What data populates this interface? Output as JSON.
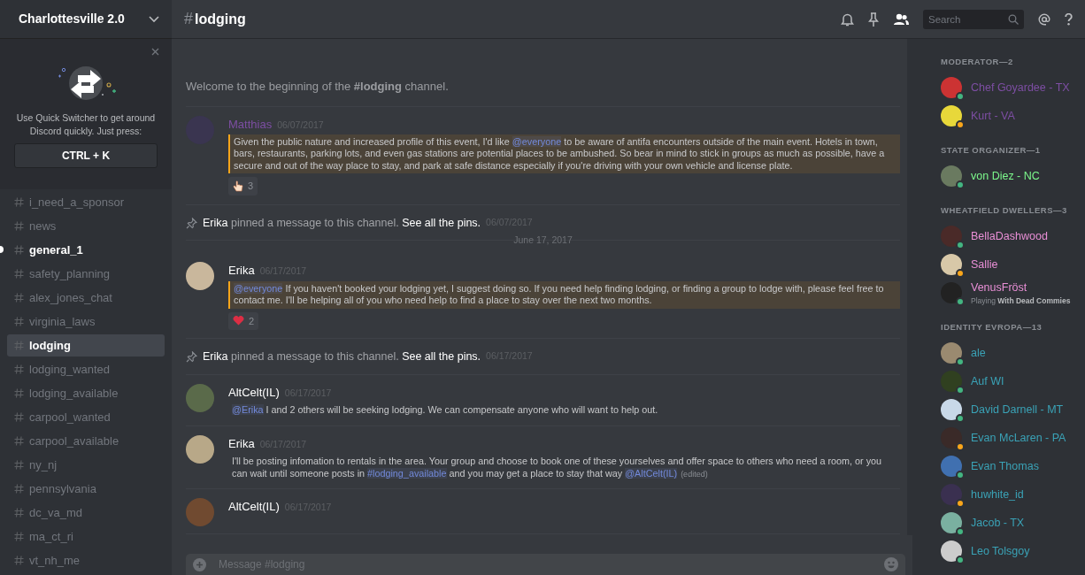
{
  "server": {
    "name": "Charlottesville 2.0"
  },
  "quick_switcher": {
    "text": "Use Quick Switcher to get around Discord quickly. Just press:",
    "shortcut": "CTRL + K"
  },
  "channels": [
    {
      "name": "i_need_a_sponsor",
      "selected": false,
      "unread": false
    },
    {
      "name": "news",
      "selected": false,
      "unread": false
    },
    {
      "name": "general_1",
      "selected": false,
      "unread": true
    },
    {
      "name": "safety_planning",
      "selected": false,
      "unread": false
    },
    {
      "name": "alex_jones_chat",
      "selected": false,
      "unread": false
    },
    {
      "name": "virginia_laws",
      "selected": false,
      "unread": false
    },
    {
      "name": "lodging",
      "selected": true,
      "unread": false
    },
    {
      "name": "lodging_wanted",
      "selected": false,
      "unread": false
    },
    {
      "name": "lodging_available",
      "selected": false,
      "unread": false
    },
    {
      "name": "carpool_wanted",
      "selected": false,
      "unread": false
    },
    {
      "name": "carpool_available",
      "selected": false,
      "unread": false
    },
    {
      "name": "ny_nj",
      "selected": false,
      "unread": false
    },
    {
      "name": "pennsylvania",
      "selected": false,
      "unread": false
    },
    {
      "name": "dc_va_md",
      "selected": false,
      "unread": false
    },
    {
      "name": "ma_ct_ri",
      "selected": false,
      "unread": false
    },
    {
      "name": "vt_nh_me",
      "selected": false,
      "unread": false
    }
  ],
  "header": {
    "hash": "#",
    "channel": "lodging",
    "search_placeholder": "Search"
  },
  "feed": [
    {
      "kind": "welcome",
      "text": "Welcome to the beginning of the **#lodging** channel."
    },
    {
      "kind": "message",
      "author": "Matthias",
      "color": "#7d4ea3",
      "time": "06/07/2017",
      "highlighted": true,
      "parts": [
        {
          "kind": "text",
          "text": "Given the public nature and increased profile of this event, I'd like "
        },
        {
          "kind": "mention",
          "text": "@everyone"
        },
        {
          "kind": "text",
          "text": " to be aware of antifa encounters outside of the main event. Hotels in town, bars, restaurants, parking lots, and even gas stations are potential places to be ambushed. So bear in mind to stick in groups as much as possible, have a secure and out of the way place to stay, and park at safe distance especially if you're driving with your own vehicle and license plate."
        }
      ],
      "reaction": {
        "kind": "hand",
        "count": "3"
      }
    },
    {
      "kind": "pin",
      "actor": "Erika",
      "text": "pinned a message to this channel.",
      "link": "See all the pins.",
      "time": "06/07/2017"
    },
    {
      "kind": "date",
      "text": "June 17, 2017"
    },
    {
      "kind": "message",
      "author": "Erika",
      "color": "#ffffff",
      "time": "06/17/2017",
      "highlighted": true,
      "parts": [
        {
          "kind": "mention",
          "text": "@everyone"
        },
        {
          "kind": "text",
          "text": " If you haven't booked your lodging yet, I suggest doing so. If you need help finding lodging, or finding a group to lodge with, please feel free to contact me. I'll be helping all of you who need help to find a place to stay over the next two months."
        }
      ],
      "reaction": {
        "kind": "heart",
        "count": "2"
      }
    },
    {
      "kind": "pin",
      "actor": "Erika",
      "text": "pinned a message to this channel.",
      "link": "See all the pins.",
      "time": "06/17/2017"
    },
    {
      "kind": "message",
      "author": "AltCelt(IL)",
      "color": "#ffffff",
      "time": "06/17/2017",
      "highlighted": false,
      "parts": [
        {
          "kind": "mention",
          "text": "@Erika"
        },
        {
          "kind": "text",
          "text": " I and 2 others will be seeking lodging. We can compensate anyone who will want to help out."
        }
      ]
    },
    {
      "kind": "message",
      "author": "Erika",
      "color": "#ffffff",
      "time": "06/17/2017",
      "highlighted": false,
      "parts": [
        {
          "kind": "text",
          "text": "I'll be posting infomation to rentals in the area. Your group and choose to book one of these yourselves and offer space to others who need a room, or you can wait until someone posts in "
        },
        {
          "kind": "mention",
          "text": "#lodging_available"
        },
        {
          "kind": "text",
          "text": " and you may get a place to stay that way  "
        },
        {
          "kind": "mention",
          "text": "@AltCelt(IL)"
        },
        {
          "kind": "edited",
          "text": "(edited)"
        }
      ]
    },
    {
      "kind": "message",
      "author": "AltCelt(IL)",
      "color": "#ffffff",
      "time": "06/17/2017"
    }
  ],
  "composer": {
    "placeholder": "Message #lodging"
  },
  "member_groups": [
    {
      "title": "MODERATOR—2",
      "members": [
        {
          "name": "Chef Goyardee - TX",
          "color": "#7d4ea3",
          "idle": false
        },
        {
          "name": "Kurt - VA",
          "color": "#7d4ea3",
          "idle": true
        }
      ]
    },
    {
      "title": "STATE ORGANIZER—1",
      "members": [
        {
          "name": "von Diez - NC",
          "color": "#7cf88c",
          "idle": false
        }
      ]
    },
    {
      "title": "WHEATFIELD DWELLERS—3",
      "members": [
        {
          "name": "BellaDashwood",
          "color": "#e98fd6",
          "idle": false
        },
        {
          "name": "Sallie",
          "color": "#e98fd6",
          "idle": true
        },
        {
          "name": "VenusFröst",
          "color": "#e98fd6",
          "idle": false,
          "activity_prefix": "Playing",
          "activity": "With Dead Commies"
        }
      ]
    },
    {
      "title": "IDENTITY EVROPA—13",
      "members": [
        {
          "name": "ale",
          "color": "#3aa2b6",
          "idle": false
        },
        {
          "name": "Auf WI",
          "color": "#3aa2b6",
          "idle": false
        },
        {
          "name": "David Darnell - MT",
          "color": "#3aa2b6",
          "idle": false
        },
        {
          "name": "Evan McLaren - PA",
          "color": "#3aa2b6",
          "idle": true
        },
        {
          "name": "Evan Thomas",
          "color": "#3aa2b6",
          "idle": false
        },
        {
          "name": "huwhite_id",
          "color": "#3aa2b6",
          "idle": true
        },
        {
          "name": "Jacob - TX",
          "color": "#3aa2b6",
          "idle": false
        },
        {
          "name": "Leo Tolsgoy",
          "color": "#3aa2b6",
          "idle": false
        }
      ]
    }
  ]
}
